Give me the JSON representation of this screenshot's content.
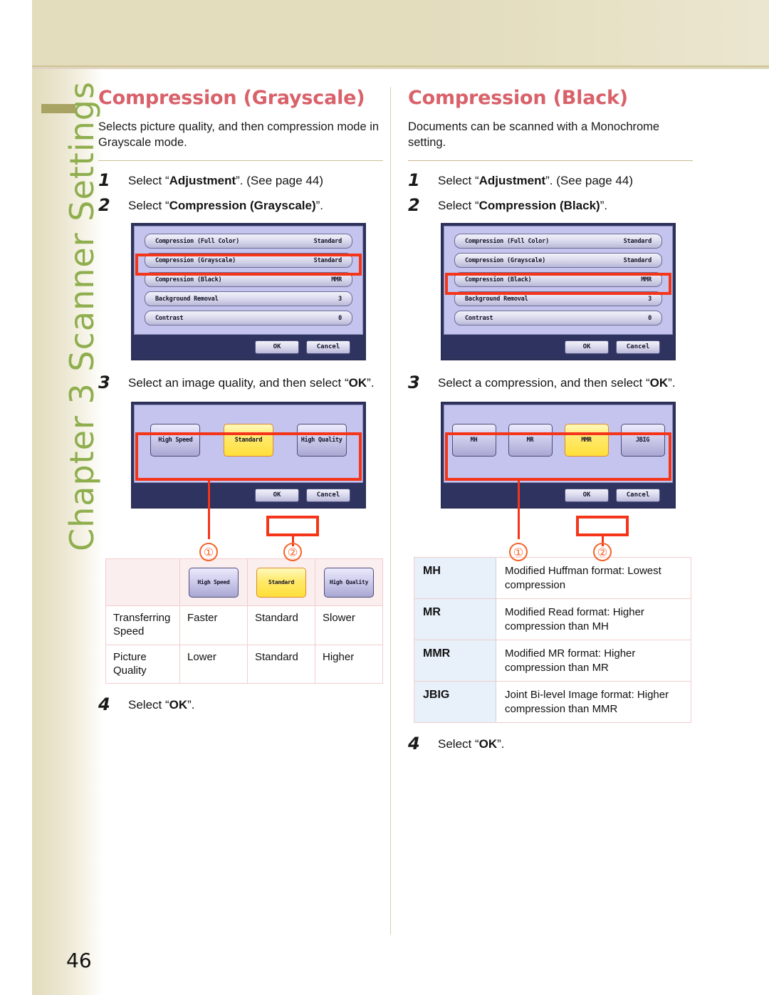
{
  "sidebar": {
    "chapter_label": "Chapter 3  Scanner Settings",
    "accent_color": "#8fae4e",
    "tab_color": "#a8a263"
  },
  "page": {
    "number": "46",
    "title_color": "#d9616a",
    "highlight_color": "#f4351a",
    "callout_color": "#f4642a"
  },
  "left_column": {
    "title": "Compression (Grayscale)",
    "description": "Selects picture quality, and then compression mode in Grayscale mode.",
    "steps": [
      {
        "num": "1",
        "text_before": "Select “",
        "bold": "Adjustment",
        "text_after": "”. (See page 44)"
      },
      {
        "num": "2",
        "text_before": "Select “",
        "bold": "Compression (Grayscale)",
        "text_after": "”."
      },
      {
        "num": "3",
        "text_before": "Select an image quality, and then select “",
        "bold": "OK",
        "text_after": "”."
      },
      {
        "num": "4",
        "text_before": "Select “",
        "bold": "OK",
        "text_after": "”."
      }
    ],
    "lcd_menu": {
      "rows": [
        {
          "label": "Compression (Full Color)",
          "value": "Standard",
          "highlighted": false
        },
        {
          "label": "Compression (Grayscale)",
          "value": "Standard",
          "highlighted": true
        },
        {
          "label": "Compression (Black)",
          "value": "MMR",
          "highlighted": false
        },
        {
          "label": "Background Removal",
          "value": "3",
          "highlighted": false
        },
        {
          "label": "Contrast",
          "value": "0",
          "highlighted": false
        }
      ],
      "ok_label": "OK",
      "cancel_label": "Cancel"
    },
    "lcd_choice": {
      "tiles": [
        {
          "label": "High Speed",
          "selected": false
        },
        {
          "label": "Standard",
          "selected": true
        },
        {
          "label": "High Quality",
          "selected": false
        }
      ],
      "ok_label": "OK",
      "cancel_label": "Cancel",
      "callout_1": "①",
      "callout_2": "②"
    },
    "table": {
      "header_cells": [
        "",
        "High Speed",
        "Standard",
        "High Quality"
      ],
      "rows": [
        {
          "label": "Transferring Speed",
          "values": [
            "Faster",
            "Standard",
            "Slower"
          ]
        },
        {
          "label": "Picture Quality",
          "values": [
            "Lower",
            "Standard",
            "Higher"
          ]
        }
      ]
    }
  },
  "right_column": {
    "title": "Compression (Black)",
    "description": "Documents can be scanned with a Monochrome setting.",
    "steps": [
      {
        "num": "1",
        "text_before": "Select “",
        "bold": "Adjustment",
        "text_after": "”. (See page 44)"
      },
      {
        "num": "2",
        "text_before": "Select “",
        "bold": "Compression (Black)",
        "text_after": "”."
      },
      {
        "num": "3",
        "text_before": "Select a compression, and then select “",
        "bold": "OK",
        "text_after": "”."
      },
      {
        "num": "4",
        "text_before": "Select “",
        "bold": "OK",
        "text_after": "”."
      }
    ],
    "lcd_menu": {
      "rows": [
        {
          "label": "Compression (Full Color)",
          "value": "Standard",
          "highlighted": false
        },
        {
          "label": "Compression (Grayscale)",
          "value": "Standard",
          "highlighted": false
        },
        {
          "label": "Compression (Black)",
          "value": "MMR",
          "highlighted": true
        },
        {
          "label": "Background Removal",
          "value": "3",
          "highlighted": false
        },
        {
          "label": "Contrast",
          "value": "0",
          "highlighted": false
        }
      ],
      "ok_label": "OK",
      "cancel_label": "Cancel"
    },
    "lcd_choice": {
      "tiles": [
        {
          "label": "MH",
          "selected": false
        },
        {
          "label": "MR",
          "selected": false
        },
        {
          "label": "MMR",
          "selected": true
        },
        {
          "label": "JBIG",
          "selected": false
        }
      ],
      "ok_label": "OK",
      "cancel_label": "Cancel",
      "callout_1": "①",
      "callout_2": "②"
    },
    "table": {
      "rows": [
        {
          "key": "MH",
          "desc": "Modified Huffman format: Lowest compression"
        },
        {
          "key": "MR",
          "desc": "Modified Read format: Higher compression than MH"
        },
        {
          "key": "MMR",
          "desc": "Modified MR format: Higher compression than MR"
        },
        {
          "key": "JBIG",
          "desc": "Joint Bi-level Image format: Higher compression than MMR"
        }
      ]
    }
  }
}
